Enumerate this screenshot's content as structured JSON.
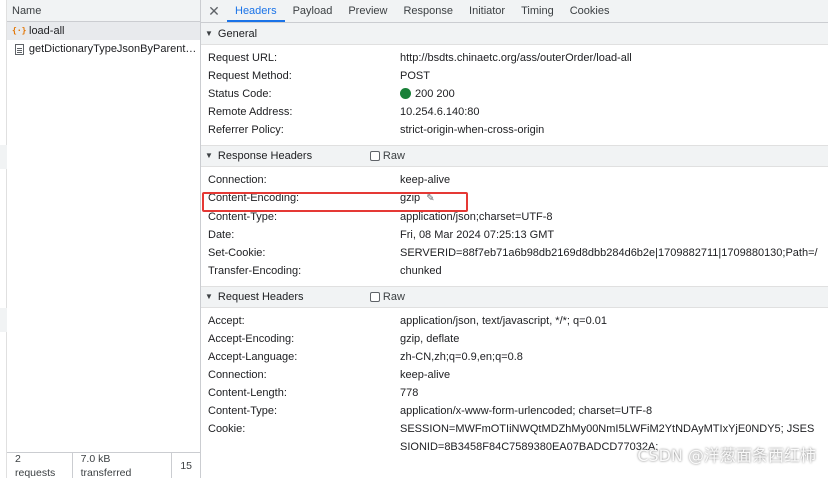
{
  "left_panel": {
    "header": "Name",
    "requests": [
      {
        "name": "load-all",
        "icon": "xhr-icon",
        "selected": true
      },
      {
        "name": "getDictionaryTypeJsonByParentC...",
        "icon": "document-icon",
        "selected": false
      }
    ],
    "footer": {
      "requests": "2 requests",
      "transferred": "7.0 kB transferred",
      "extra": "15"
    }
  },
  "tabs": [
    "Headers",
    "Payload",
    "Preview",
    "Response",
    "Initiator",
    "Timing",
    "Cookies"
  ],
  "active_tab": "Headers",
  "general": {
    "title": "General",
    "rows": [
      {
        "k": "Request URL:",
        "v": "http://bsdts.chinaetc.org/ass/outerOrder/load-all"
      },
      {
        "k": "Request Method:",
        "v": "POST"
      },
      {
        "k": "Status Code:",
        "v": "200 200"
      },
      {
        "k": "Remote Address:",
        "v": "10.254.6.140:80"
      },
      {
        "k": "Referrer Policy:",
        "v": "strict-origin-when-cross-origin"
      }
    ]
  },
  "response_headers": {
    "title": "Response Headers",
    "raw_label": "Raw",
    "rows": [
      {
        "k": "Connection:",
        "v": "keep-alive"
      },
      {
        "k": "Content-Encoding:",
        "v": "gzip"
      },
      {
        "k": "Content-Type:",
        "v": "application/json;charset=UTF-8"
      },
      {
        "k": "Date:",
        "v": "Fri, 08 Mar 2024 07:25:13 GMT"
      },
      {
        "k": "Set-Cookie:",
        "v": "SERVERID=88f7eb71a6b98db2169d8dbb284d6b2e|1709882711|1709880130;Path=/"
      },
      {
        "k": "Transfer-Encoding:",
        "v": "chunked"
      }
    ]
  },
  "request_headers": {
    "title": "Request Headers",
    "raw_label": "Raw",
    "rows": [
      {
        "k": "Accept:",
        "v": "application/json, text/javascript, */*; q=0.01"
      },
      {
        "k": "Accept-Encoding:",
        "v": "gzip, deflate"
      },
      {
        "k": "Accept-Language:",
        "v": "zh-CN,zh;q=0.9,en;q=0.8"
      },
      {
        "k": "Connection:",
        "v": "keep-alive"
      },
      {
        "k": "Content-Length:",
        "v": "778"
      },
      {
        "k": "Content-Type:",
        "v": "application/x-www-form-urlencoded; charset=UTF-8"
      },
      {
        "k": "Cookie:",
        "v": "SESSION=MWFmOTIiNWQtMDZhMy00NmI5LWFiM2YtNDAyMTIxYjE0NDY5; JSESSIONID=8B3458F84C7589380EA07BADCD77032A;"
      }
    ]
  },
  "watermark": "CSDN @洋葱面条西红柿",
  "colors": {
    "accent": "#1a73e8",
    "status_ok": "#188038",
    "highlight": "#e53935"
  }
}
